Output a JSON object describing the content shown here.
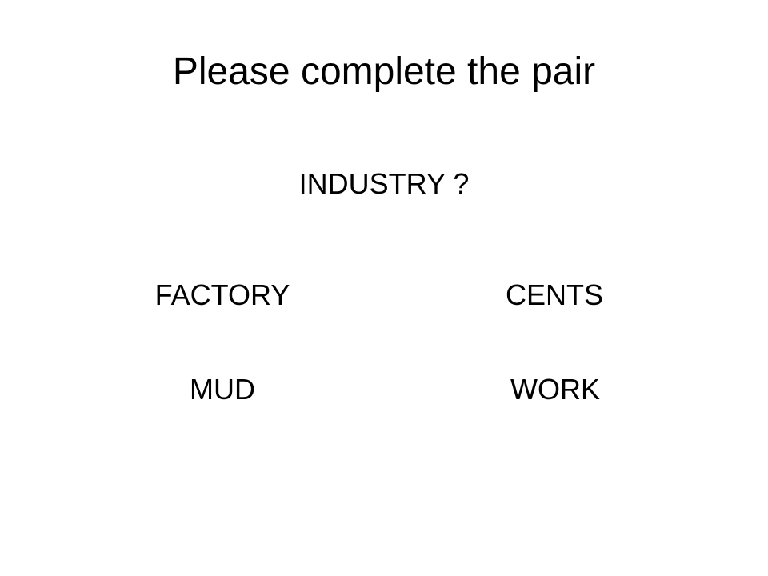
{
  "slide": {
    "title": "Please complete the pair",
    "prompt": "INDUSTRY ?",
    "options": [
      {
        "label": "FACTORY"
      },
      {
        "label": "CENTS"
      },
      {
        "label": "MUD"
      },
      {
        "label": "WORK"
      }
    ]
  }
}
